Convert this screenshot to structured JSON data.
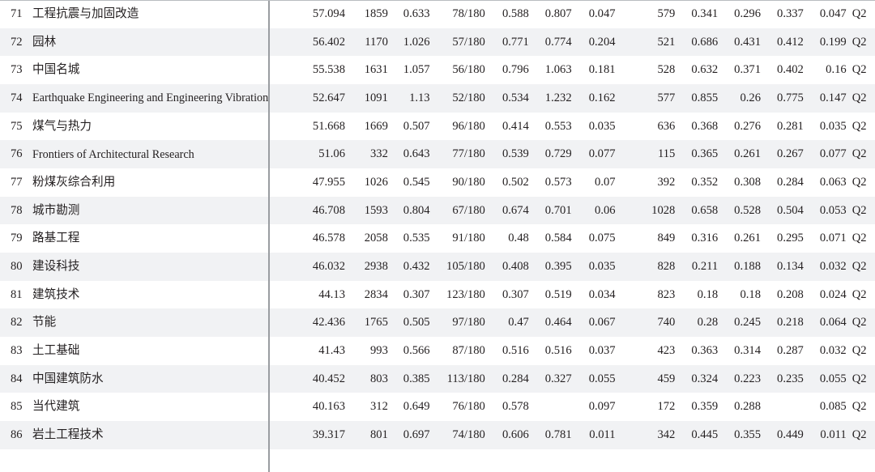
{
  "table": {
    "columns": [
      "index",
      "journal_name",
      "composite_score",
      "citations",
      "impact_factor",
      "rank_in_category",
      "metric_5",
      "metric_6",
      "metric_7",
      "count_2",
      "metric_9",
      "metric_10",
      "metric_11",
      "metric_12",
      "quartile"
    ],
    "divider_color": "#9a9da1",
    "rule_color": "#b9bcc0",
    "alt_row_color": "#f1f2f4",
    "text_color": "#231f20",
    "rows": [
      {
        "index": "71",
        "name": "工程抗震与加固改造",
        "latin": false,
        "c1": "57.094",
        "c2": "1859",
        "c3": "0.633",
        "c4": "78/180",
        "c5": "0.588",
        "c6": "0.807",
        "c7": "0.047",
        "c8": "579",
        "c9": "0.341",
        "c10": "0.296",
        "c11": "0.337",
        "c12": "0.047",
        "c13": "Q2"
      },
      {
        "index": "72",
        "name": "园林",
        "latin": false,
        "c1": "56.402",
        "c2": "1170",
        "c3": "1.026",
        "c4": "57/180",
        "c5": "0.771",
        "c6": "0.774",
        "c7": "0.204",
        "c8": "521",
        "c9": "0.686",
        "c10": "0.431",
        "c11": "0.412",
        "c12": "0.199",
        "c13": "Q2"
      },
      {
        "index": "73",
        "name": "中国名城",
        "latin": false,
        "c1": "55.538",
        "c2": "1631",
        "c3": "1.057",
        "c4": "56/180",
        "c5": "0.796",
        "c6": "1.063",
        "c7": "0.181",
        "c8": "528",
        "c9": "0.632",
        "c10": "0.371",
        "c11": "0.402",
        "c12": "0.16",
        "c13": "Q2"
      },
      {
        "index": "74",
        "name": "Earthquake Engineering and Engineering Vibration",
        "latin": true,
        "c1": "52.647",
        "c2": "1091",
        "c3": "1.13",
        "c4": "52/180",
        "c5": "0.534",
        "c6": "1.232",
        "c7": "0.162",
        "c8": "577",
        "c9": "0.855",
        "c10": "0.26",
        "c11": "0.775",
        "c12": "0.147",
        "c13": "Q2"
      },
      {
        "index": "75",
        "name": "煤气与热力",
        "latin": false,
        "c1": "51.668",
        "c2": "1669",
        "c3": "0.507",
        "c4": "96/180",
        "c5": "0.414",
        "c6": "0.553",
        "c7": "0.035",
        "c8": "636",
        "c9": "0.368",
        "c10": "0.276",
        "c11": "0.281",
        "c12": "0.035",
        "c13": "Q2"
      },
      {
        "index": "76",
        "name": "Frontiers of Architectural Research",
        "latin": true,
        "c1": "51.06",
        "c2": "332",
        "c3": "0.643",
        "c4": "77/180",
        "c5": "0.539",
        "c6": "0.729",
        "c7": "0.077",
        "c8": "115",
        "c9": "0.365",
        "c10": "0.261",
        "c11": "0.267",
        "c12": "0.077",
        "c13": "Q2"
      },
      {
        "index": "77",
        "name": "粉煤灰综合利用",
        "latin": false,
        "c1": "47.955",
        "c2": "1026",
        "c3": "0.545",
        "c4": "90/180",
        "c5": "0.502",
        "c6": "0.573",
        "c7": "0.07",
        "c8": "392",
        "c9": "0.352",
        "c10": "0.308",
        "c11": "0.284",
        "c12": "0.063",
        "c13": "Q2"
      },
      {
        "index": "78",
        "name": "城市勘测",
        "latin": false,
        "c1": "46.708",
        "c2": "1593",
        "c3": "0.804",
        "c4": "67/180",
        "c5": "0.674",
        "c6": "0.701",
        "c7": "0.06",
        "c8": "1028",
        "c9": "0.658",
        "c10": "0.528",
        "c11": "0.504",
        "c12": "0.053",
        "c13": "Q2"
      },
      {
        "index": "79",
        "name": "路基工程",
        "latin": false,
        "c1": "46.578",
        "c2": "2058",
        "c3": "0.535",
        "c4": "91/180",
        "c5": "0.48",
        "c6": "0.584",
        "c7": "0.075",
        "c8": "849",
        "c9": "0.316",
        "c10": "0.261",
        "c11": "0.295",
        "c12": "0.071",
        "c13": "Q2"
      },
      {
        "index": "80",
        "name": "建设科技",
        "latin": false,
        "c1": "46.032",
        "c2": "2938",
        "c3": "0.432",
        "c4": "105/180",
        "c5": "0.408",
        "c6": "0.395",
        "c7": "0.035",
        "c8": "828",
        "c9": "0.211",
        "c10": "0.188",
        "c11": "0.134",
        "c12": "0.032",
        "c13": "Q2"
      },
      {
        "index": "81",
        "name": "建筑技术",
        "latin": false,
        "c1": "44.13",
        "c2": "2834",
        "c3": "0.307",
        "c4": "123/180",
        "c5": "0.307",
        "c6": "0.519",
        "c7": "0.034",
        "c8": "823",
        "c9": "0.18",
        "c10": "0.18",
        "c11": "0.208",
        "c12": "0.024",
        "c13": "Q2"
      },
      {
        "index": "82",
        "name": "节能",
        "latin": false,
        "c1": "42.436",
        "c2": "1765",
        "c3": "0.505",
        "c4": "97/180",
        "c5": "0.47",
        "c6": "0.464",
        "c7": "0.067",
        "c8": "740",
        "c9": "0.28",
        "c10": "0.245",
        "c11": "0.218",
        "c12": "0.064",
        "c13": "Q2"
      },
      {
        "index": "83",
        "name": "土工基础",
        "latin": false,
        "c1": "41.43",
        "c2": "993",
        "c3": "0.566",
        "c4": "87/180",
        "c5": "0.516",
        "c6": "0.516",
        "c7": "0.037",
        "c8": "423",
        "c9": "0.363",
        "c10": "0.314",
        "c11": "0.287",
        "c12": "0.032",
        "c13": "Q2"
      },
      {
        "index": "84",
        "name": "中国建筑防水",
        "latin": false,
        "c1": "40.452",
        "c2": "803",
        "c3": "0.385",
        "c4": "113/180",
        "c5": "0.284",
        "c6": "0.327",
        "c7": "0.055",
        "c8": "459",
        "c9": "0.324",
        "c10": "0.223",
        "c11": "0.235",
        "c12": "0.055",
        "c13": "Q2"
      },
      {
        "index": "85",
        "name": "当代建筑",
        "latin": false,
        "c1": "40.163",
        "c2": "312",
        "c3": "0.649",
        "c4": "76/180",
        "c5": "0.578",
        "c6": "",
        "c7": "0.097",
        "c8": "172",
        "c9": "0.359",
        "c10": "0.288",
        "c11": "",
        "c12": "0.085",
        "c13": "Q2"
      },
      {
        "index": "86",
        "name": "岩土工程技术",
        "latin": false,
        "c1": "39.317",
        "c2": "801",
        "c3": "0.697",
        "c4": "74/180",
        "c5": "0.606",
        "c6": "0.781",
        "c7": "0.011",
        "c8": "342",
        "c9": "0.445",
        "c10": "0.355",
        "c11": "0.449",
        "c12": "0.011",
        "c13": "Q2"
      }
    ]
  }
}
